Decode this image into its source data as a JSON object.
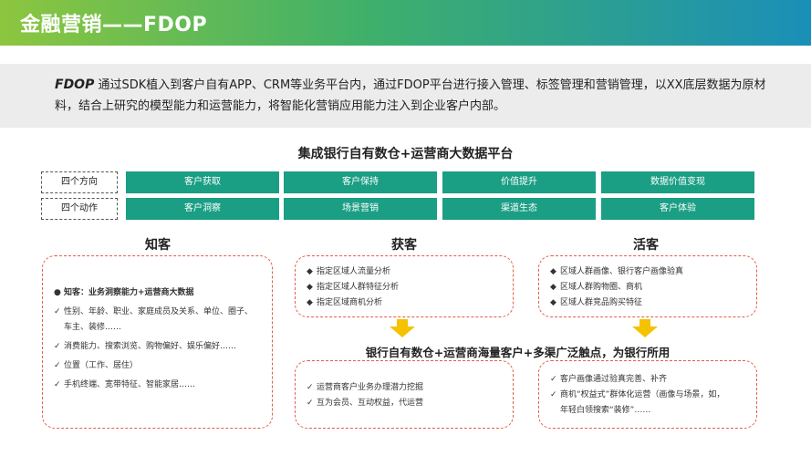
{
  "header": {
    "title": "金融营销——FDOP"
  },
  "intro": {
    "brand": "FDOP",
    "text": " 通过SDK植入到客户自有APP、CRM等业务平台内，通过FDOP平台进行接入管理、标签管理和营销管理，以XX底层数据为原材料，结合上研究的模型能力和运营能力，将智能化营销应用能力注入到企业客户内部。"
  },
  "platform": {
    "title": "集成银行自有数仓+运营商大数据平台",
    "rows": [
      {
        "label": "四个方向",
        "cells": [
          "客户获取",
          "客户保持",
          "价值提升",
          "数据价值变现"
        ]
      },
      {
        "label": "四个动作",
        "cells": [
          "客户洞察",
          "场景营销",
          "渠道生态",
          "客户体验"
        ]
      }
    ]
  },
  "stages": [
    {
      "title": "知客",
      "items": [
        {
          "marker": "●",
          "text": "知客：业务洞察能力+运营商大数据",
          "bold": true
        },
        {
          "marker": "✓",
          "text": "性别、年龄、职业、家庭成员及关系、单位、圈子、"
        },
        {
          "marker": "",
          "text": "车主、装修……"
        },
        {
          "marker": "✓",
          "text": "消费能力、搜索浏览、购物偏好、娱乐偏好……"
        },
        {
          "marker": "✓",
          "text": "位置（工作、居住）"
        },
        {
          "marker": "✓",
          "text": "手机终端、宽带特征、智能家居……"
        }
      ]
    },
    {
      "title": "获客",
      "items": [
        {
          "marker": "◆",
          "text": "指定区域人流量分析"
        },
        {
          "marker": "◆",
          "text": "指定区域人群特征分析"
        },
        {
          "marker": "◆",
          "text": "指定区域商机分析"
        }
      ]
    },
    {
      "title": "活客",
      "items": [
        {
          "marker": "◆",
          "text": "区域人群画像、银行客户画像验真"
        },
        {
          "marker": "◆",
          "text": "区域人群购物圈、商机"
        },
        {
          "marker": "◆",
          "text": "区域人群竞品购买特征"
        }
      ]
    }
  ],
  "middle": {
    "title": "银行自有数仓+运营商海量客户+多渠广泛触点，为银行所用"
  },
  "bottom": [
    {
      "items": [
        {
          "marker": "✓",
          "text": "运营商客户业务办理潜力挖掘"
        },
        {
          "marker": "✓",
          "text": "互为会员、互动权益，代运营"
        }
      ]
    },
    {
      "items": [
        {
          "marker": "✓",
          "text": "客户画像通过验真完善、补齐"
        },
        {
          "marker": "✓",
          "text": "商机“权益式”群体化运营（画像与场景，如，"
        },
        {
          "marker": "",
          "text": "年轻白领搜索“装修”……"
        }
      ]
    }
  ],
  "colors": {
    "accent": "#1a9e84",
    "dash": "#e0604a",
    "arrow": "#f5c200"
  }
}
